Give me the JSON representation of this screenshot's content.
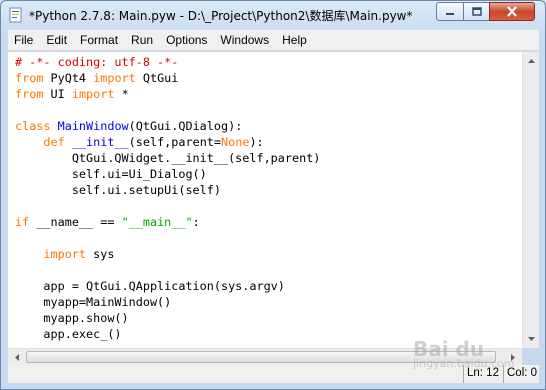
{
  "window": {
    "title": "*Python 2.7.8: Main.pyw - D:\\_Project\\Python2\\数据库\\Main.pyw*"
  },
  "menubar": {
    "items": [
      "File",
      "Edit",
      "Format",
      "Run",
      "Options",
      "Windows",
      "Help"
    ]
  },
  "editor": {
    "lines": [
      [
        {
          "t": "# -*- coding: utf-8 -*-",
          "c": "cm"
        }
      ],
      [
        {
          "t": "from",
          "c": "kw"
        },
        {
          "t": " PyQt4 ",
          "c": ""
        },
        {
          "t": "import",
          "c": "kw"
        },
        {
          "t": " QtGui",
          "c": ""
        }
      ],
      [
        {
          "t": "from",
          "c": "kw"
        },
        {
          "t": " UI ",
          "c": ""
        },
        {
          "t": "import",
          "c": "kw"
        },
        {
          "t": " *",
          "c": ""
        }
      ],
      [],
      [
        {
          "t": "class",
          "c": "kw"
        },
        {
          "t": " ",
          "c": ""
        },
        {
          "t": "MainWindow",
          "c": "df"
        },
        {
          "t": "(QtGui.QDialog):",
          "c": ""
        }
      ],
      [
        {
          "t": "    ",
          "c": ""
        },
        {
          "t": "def",
          "c": "kw"
        },
        {
          "t": " ",
          "c": ""
        },
        {
          "t": "__init__",
          "c": "df"
        },
        {
          "t": "(self,parent=",
          "c": ""
        },
        {
          "t": "None",
          "c": "kw"
        },
        {
          "t": "):",
          "c": ""
        }
      ],
      [
        {
          "t": "        QtGui.QWidget.__init__(self,parent)",
          "c": ""
        }
      ],
      [
        {
          "t": "        self.ui=Ui_Dialog()",
          "c": ""
        }
      ],
      [
        {
          "t": "        self.ui.setupUi(self)",
          "c": ""
        }
      ],
      [],
      [
        {
          "t": "if",
          "c": "kw"
        },
        {
          "t": " __name__ == ",
          "c": ""
        },
        {
          "t": "\"__main__\"",
          "c": "st"
        },
        {
          "t": ":",
          "c": ""
        }
      ],
      [],
      [
        {
          "t": "    ",
          "c": ""
        },
        {
          "t": "import",
          "c": "kw"
        },
        {
          "t": " sys",
          "c": ""
        }
      ],
      [],
      [
        {
          "t": "    app = QtGui.QApplication(sys.argv)",
          "c": ""
        }
      ],
      [
        {
          "t": "    myapp=MainWindow()",
          "c": ""
        }
      ],
      [
        {
          "t": "    myapp.show()",
          "c": ""
        }
      ],
      [
        {
          "t": "    app.exec_()",
          "c": ""
        }
      ]
    ]
  },
  "statusbar": {
    "line": "Ln: 12",
    "col": "Col: 0"
  },
  "watermark": {
    "text": "Bai du",
    "sub": "jingyan.baidu.com"
  },
  "colors": {
    "comment": "#dd0000",
    "keyword": "#ff7700",
    "definition": "#0000ff",
    "string": "#00aa00"
  }
}
